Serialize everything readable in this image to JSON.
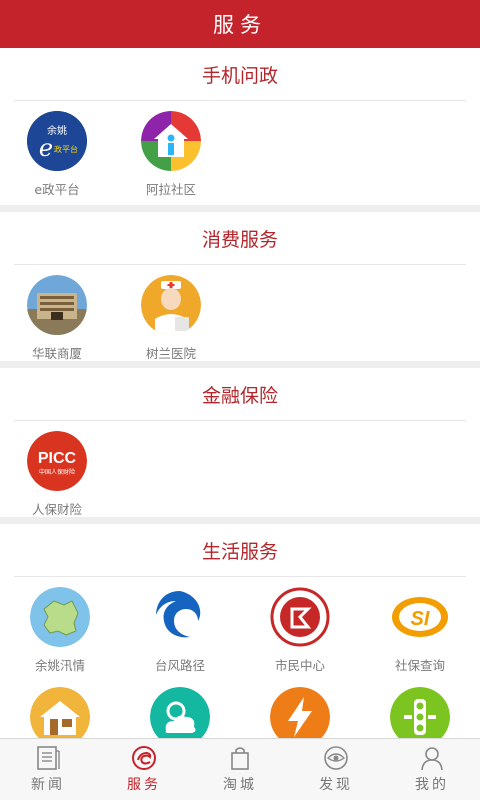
{
  "header": {
    "title": "服务"
  },
  "sections": [
    {
      "title": "手机问政",
      "items": [
        {
          "label": "e政平台",
          "icon": "yuyao-e-zheng-logo-icon",
          "icon_text": "余姚",
          "icon_sub": "政平台"
        },
        {
          "label": "阿拉社区",
          "icon": "community-house-icon"
        }
      ]
    },
    {
      "title": "消费服务",
      "items": [
        {
          "label": "华联商厦",
          "icon": "shopping-mall-building-icon"
        },
        {
          "label": "树兰医院",
          "icon": "nurse-hospital-icon"
        }
      ]
    },
    {
      "title": "金融保险",
      "items": [
        {
          "label": "人保财险",
          "icon": "picc-logo-icon",
          "icon_text": "PICC",
          "icon_sub": "中国人保财险"
        }
      ]
    },
    {
      "title": "生活服务",
      "items": [
        {
          "label": "余姚汛情",
          "icon": "flood-map-icon"
        },
        {
          "label": "台风路径",
          "icon": "typhoon-icon"
        },
        {
          "label": "市民中心",
          "icon": "citizen-center-logo-icon"
        },
        {
          "label": "社保查询",
          "icon": "social-security-logo-icon",
          "icon_text": "SI"
        },
        {
          "label": "",
          "icon": "house-icon"
        },
        {
          "label": "",
          "icon": "weather-icon"
        },
        {
          "label": "",
          "icon": "lightning-icon"
        },
        {
          "label": "",
          "icon": "traffic-light-icon"
        }
      ]
    }
  ],
  "bottom_nav": [
    {
      "label": "新闻",
      "icon": "newspaper-icon",
      "active": false
    },
    {
      "label": "服务",
      "icon": "service-icon",
      "active": true
    },
    {
      "label": "淘城",
      "icon": "shopping-bag-icon",
      "active": false
    },
    {
      "label": "发现",
      "icon": "eye-icon",
      "active": false
    },
    {
      "label": "我的",
      "icon": "user-icon",
      "active": false
    }
  ],
  "colors": {
    "brand_red": "#c4232b",
    "section_title": "#b3262b",
    "label_gray": "#7a7a7a"
  }
}
